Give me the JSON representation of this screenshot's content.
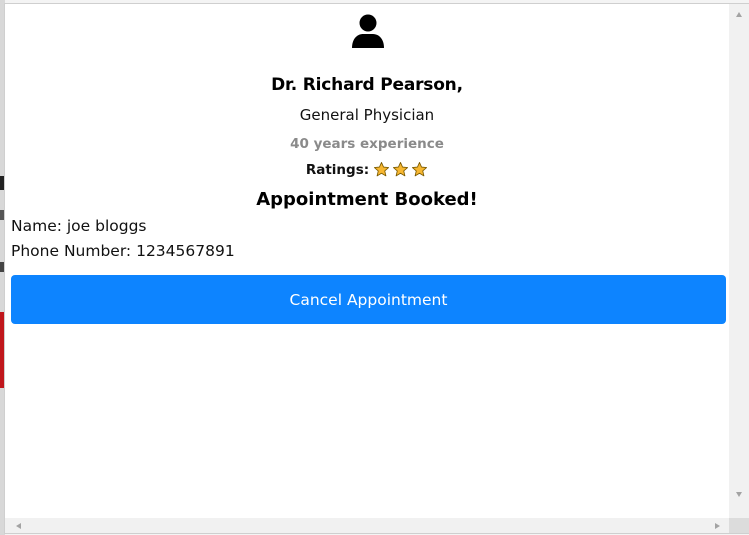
{
  "doctor": {
    "avatar_icon": "user-icon",
    "name": "Dr. Richard Pearson,",
    "specialty": "General Physician",
    "experience": "40 years experience",
    "ratings_label": "Ratings:",
    "rating_stars": 3,
    "star_color": "#f7b731"
  },
  "appointment": {
    "status": "Appointment Booked!",
    "name_line": "Name: joe bloggs",
    "phone_line": "Phone Number: 1234567891",
    "cancel_label": "Cancel Appointment",
    "accent_color": "#0d84ff"
  }
}
